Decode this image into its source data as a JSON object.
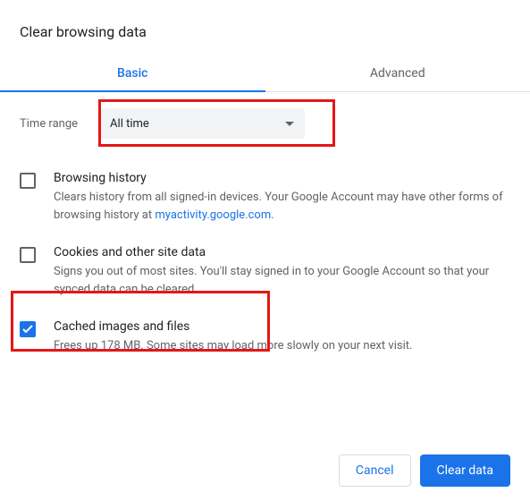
{
  "title": "Clear browsing data",
  "tabs": {
    "basic": "Basic",
    "advanced": "Advanced"
  },
  "time": {
    "label": "Time range",
    "value": "All time"
  },
  "options": {
    "history": {
      "title": "Browsing history",
      "desc_pre": "Clears history from all signed-in devices. Your Google Account may have other forms of browsing history at ",
      "link": "myactivity.google.com",
      "desc_post": "."
    },
    "cookies": {
      "title": "Cookies and other site data",
      "desc": "Signs you out of most sites. You'll stay signed in to your Google Account so that your synced data can be cleared."
    },
    "cache": {
      "title": "Cached images and files",
      "desc": "Frees up 178 MB. Some sites may load more slowly on your next visit."
    }
  },
  "buttons": {
    "cancel": "Cancel",
    "clear": "Clear data"
  }
}
